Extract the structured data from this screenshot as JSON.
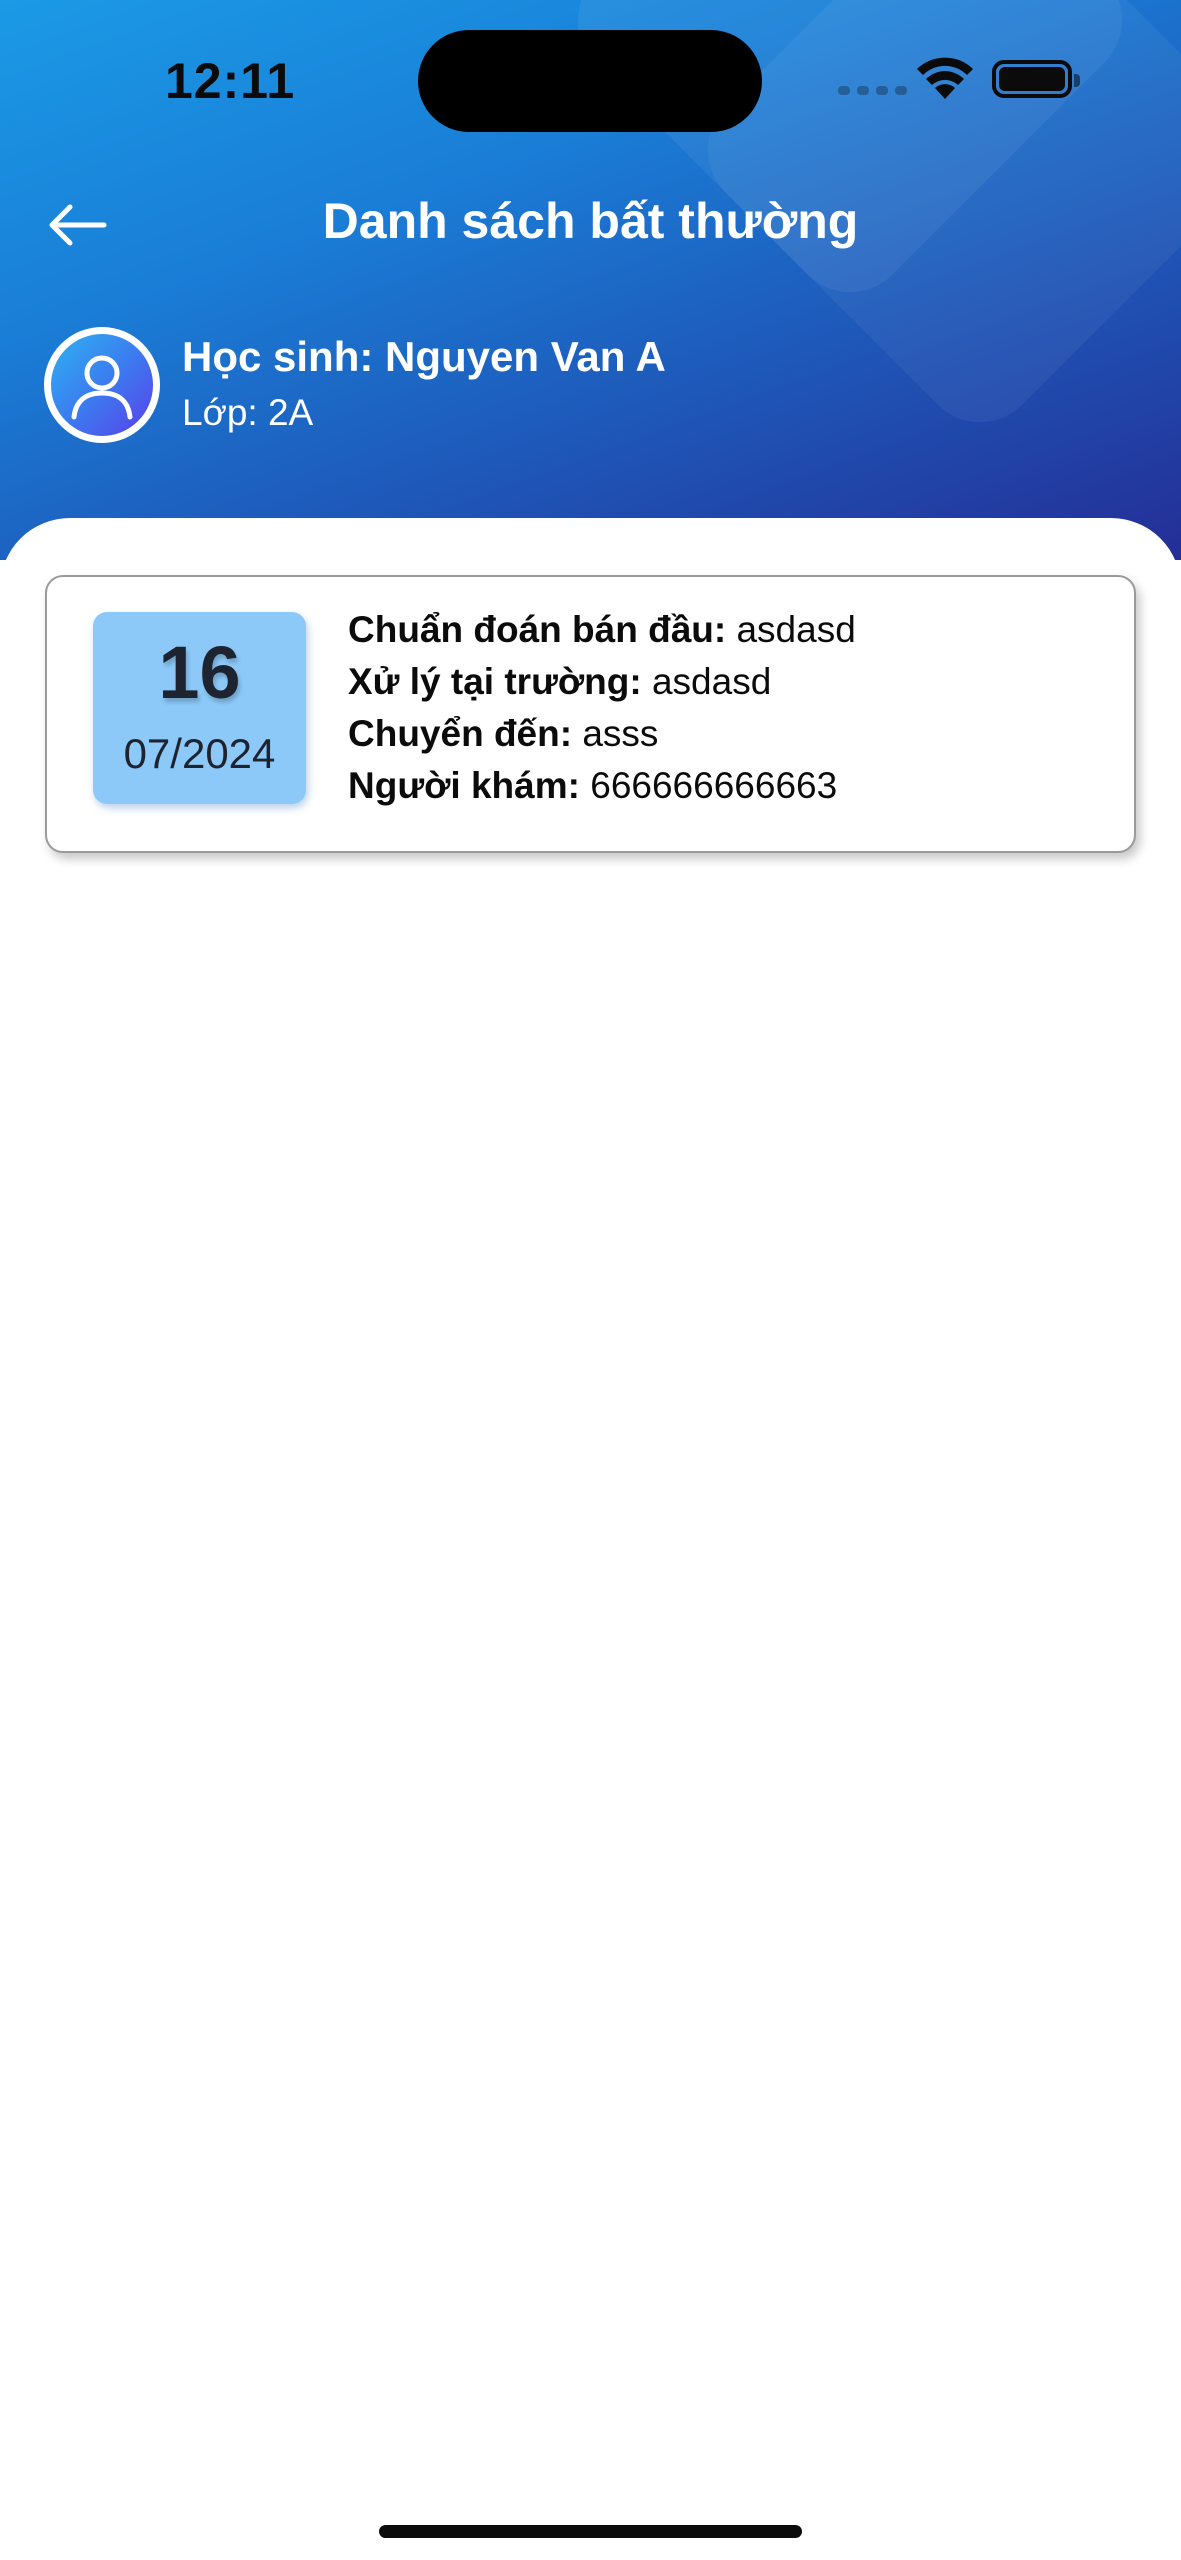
{
  "status_bar": {
    "time": "12:11"
  },
  "header": {
    "title": "Danh sách bất thường",
    "back_icon": "arrow-left-icon"
  },
  "student": {
    "name": "Học sinh: Nguyen Van A",
    "class": "Lớp: 2A",
    "avatar_icon": "user-icon"
  },
  "records": [
    {
      "day": "16",
      "month_year": "07/2024",
      "diagnosis_label": "Chuẩn đoán bán đầu:",
      "diagnosis_value": "asdasd",
      "treatment_label": "Xử lý tại trường:",
      "treatment_value": "asdasd",
      "transfer_label": "Chuyển đến:",
      "transfer_value": "asss",
      "examiner_label": "Người khám:",
      "examiner_value": "666666666663"
    }
  ],
  "colors": {
    "header_gradient_start": "#1b9ae6",
    "header_gradient_end": "#242e96",
    "date_box": "#8cc9f8",
    "card_border": "#9a9a9a"
  }
}
